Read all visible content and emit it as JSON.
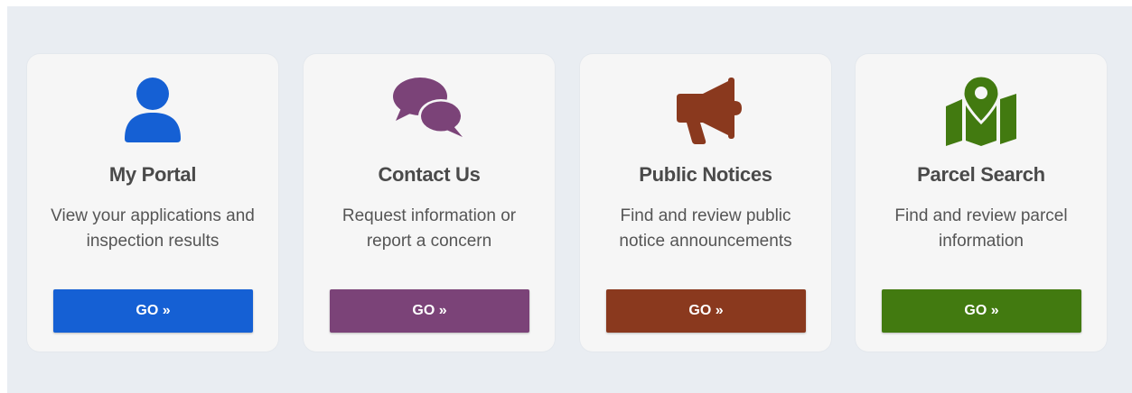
{
  "cards": [
    {
      "icon": "user-icon",
      "title": "My Portal",
      "description": "View your applications and inspection results",
      "button_label": "GO »",
      "color": "#1560d4"
    },
    {
      "icon": "chat-bubbles-icon",
      "title": "Contact Us",
      "description": "Request information or report a concern",
      "button_label": "GO »",
      "color": "#7b4378"
    },
    {
      "icon": "megaphone-icon",
      "title": "Public Notices",
      "description": "Find and review public notice announcements",
      "button_label": "GO »",
      "color": "#8a391e"
    },
    {
      "icon": "map-pin-icon",
      "title": "Parcel Search",
      "description": "Find and review parcel information",
      "button_label": "GO »",
      "color": "#427a10"
    }
  ]
}
